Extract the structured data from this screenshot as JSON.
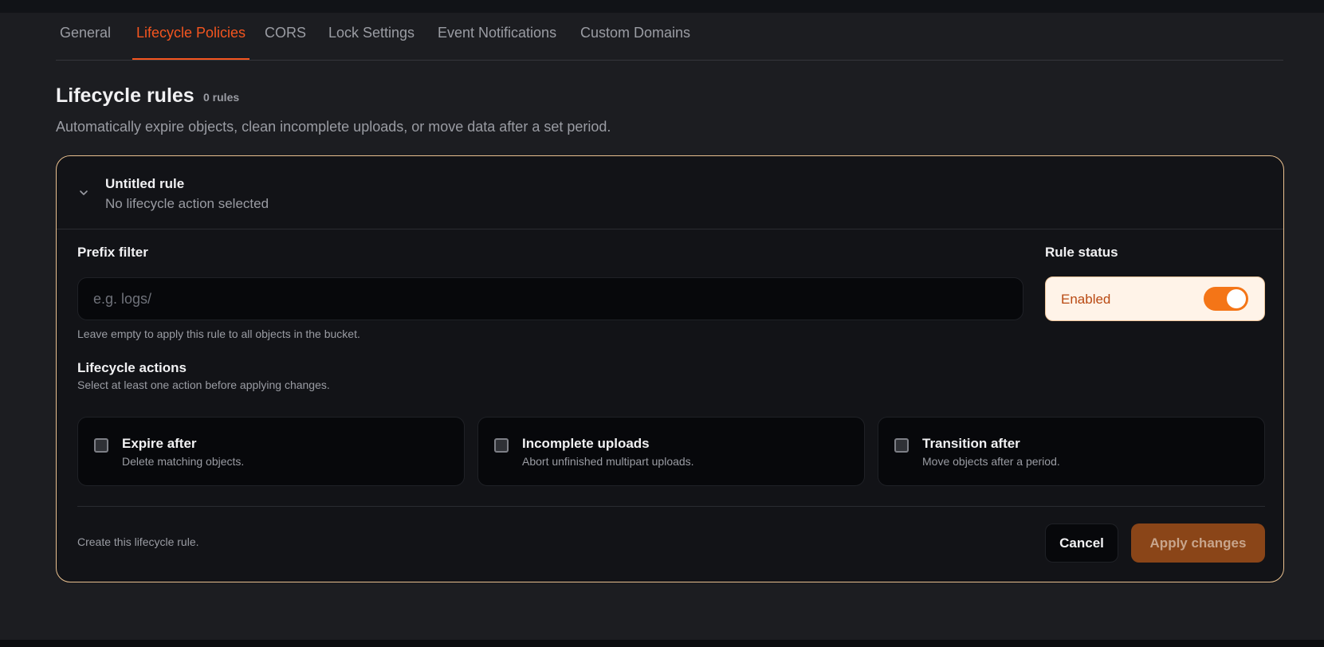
{
  "tabs": [
    {
      "label": "General"
    },
    {
      "label": "Lifecycle Policies",
      "active": true
    },
    {
      "label": "CORS"
    },
    {
      "label": "Lock Settings"
    },
    {
      "label": "Event Notifications"
    },
    {
      "label": "Custom Domains"
    }
  ],
  "section": {
    "title": "Lifecycle rules",
    "count": "0 rules",
    "description": "Automatically expire objects, clean incomplete uploads, or move data after a set period."
  },
  "rule": {
    "name": "Untitled rule",
    "summary": "No lifecycle action selected",
    "expand_icon": "chevron-down-icon",
    "prefix": {
      "label": "Prefix filter",
      "value": "",
      "placeholder": "e.g. logs/",
      "hint": "Leave empty to apply this rule to all objects in the bucket."
    },
    "status": {
      "label": "Rule status",
      "value": "Enabled",
      "enabled": true
    },
    "actions": {
      "label": "Lifecycle actions",
      "hint": "Select at least one action before applying changes.",
      "items": [
        {
          "title": "Expire after",
          "description": "Delete matching objects.",
          "checked": false
        },
        {
          "title": "Incomplete uploads",
          "description": "Abort unfinished multipart uploads.",
          "checked": false
        },
        {
          "title": "Transition after",
          "description": "Move objects after a period.",
          "checked": false
        }
      ]
    },
    "footer": {
      "note": "Create this lifecycle rule.",
      "cancel_label": "Cancel",
      "apply_label": "Apply changes",
      "apply_disabled": true
    }
  },
  "colors": {
    "accent": "#f4551f",
    "toggle_on": "#f47517",
    "card_border": "#e9c08f",
    "background": "#1c1d21"
  }
}
